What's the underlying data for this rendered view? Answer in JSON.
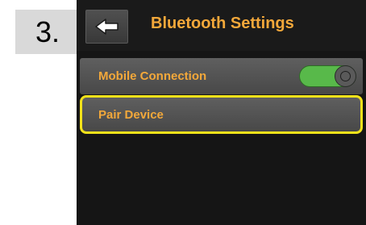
{
  "step": {
    "number": "3."
  },
  "header": {
    "back_icon": "arrow-left-icon",
    "title": "Bluetooth Settings"
  },
  "settings": {
    "mobile_connection": {
      "label": "Mobile Connection",
      "toggle_on": true
    },
    "pair_device": {
      "label": "Pair Device",
      "highlighted": true
    }
  },
  "colors": {
    "accent_text": "#f3a83a",
    "highlight_border": "#f2e21a",
    "toggle_on": "#58b94a"
  }
}
